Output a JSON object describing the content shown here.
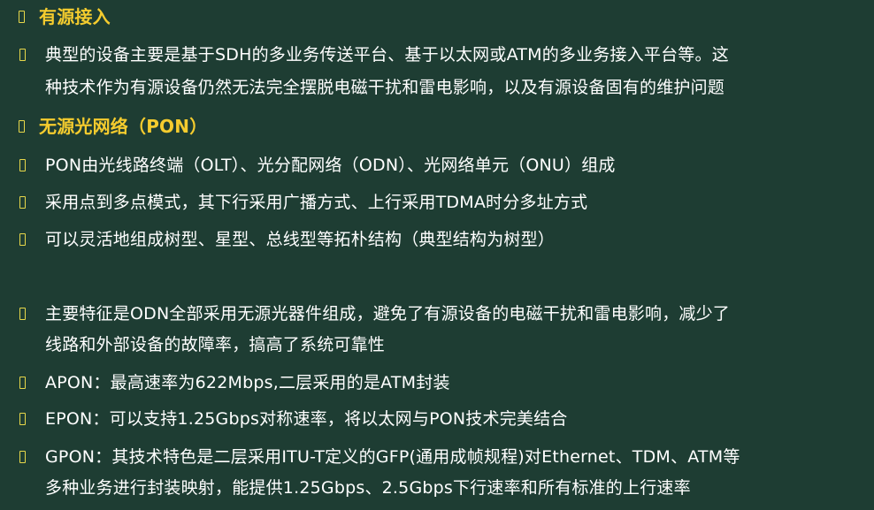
{
  "sections": [
    {
      "heading": "有源接入",
      "items": [
        {
          "line1": "典型的设备主要是基于SDH的多业务传送平台、基于以太网或ATM的多业务接入平台等。这",
          "line2": "种技术作为有源设备仍然无法完全摆脱电磁干扰和雷电影响，以及有源设备固有的维护问题"
        }
      ]
    },
    {
      "heading": "无源光网络（PON）",
      "items": [
        {
          "line1": "PON由光线路终端（OLT）、光分配网络（ODN）、光网络单元（ONU）组成"
        },
        {
          "line1": "采用点到多点模式，其下行采用广播方式、上行采用TDMA时分多址方式"
        },
        {
          "line1": "可以灵活地组成树型、星型、总线型等拓朴结构（典型结构为树型）"
        },
        {
          "line1": "主要特征是ODN全部采用无源光器件组成，避免了有源设备的电磁干扰和雷电影响，减少了",
          "line2": "线路和外部设备的故障率，搞高了系统可靠性"
        },
        {
          "line1": "APON：最高速率为622Mbps,二层采用的是ATM封装"
        },
        {
          "line1": "EPON：可以支持1.25Gbps对称速率，将以太网与PON技术完美结合"
        },
        {
          "line1": "GPON：其技术特色是二层采用ITU-T定义的GFP(通用成帧规程)对Ethernet、TDM、ATM等",
          "line2": "多种业务进行封装映射，能提供1.25Gbps、2.5Gbps下行速率和所有标准的上行速率"
        }
      ]
    }
  ]
}
